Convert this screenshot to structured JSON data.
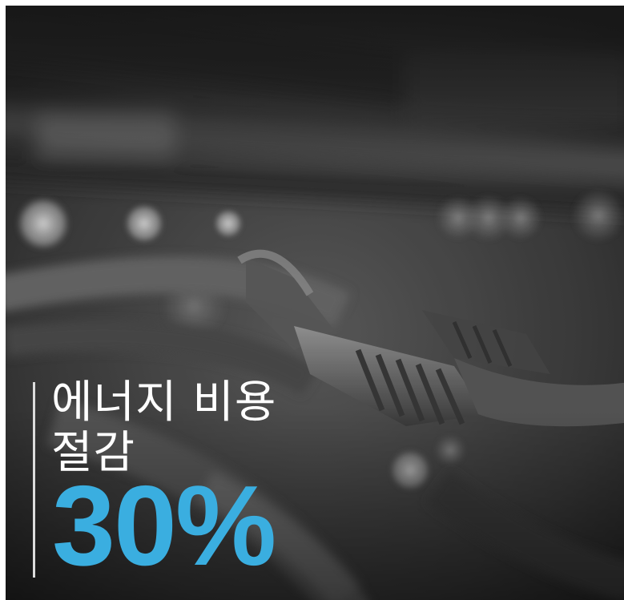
{
  "headline": {
    "line1": "에너지 비용",
    "line2": "절감",
    "value": "30%"
  },
  "image": {
    "subject": "network-cables-photo",
    "tone": "grayscale"
  },
  "colors": {
    "accent": "#3aaee0",
    "text": "#ffffff",
    "divider": "#dcdcdc"
  }
}
